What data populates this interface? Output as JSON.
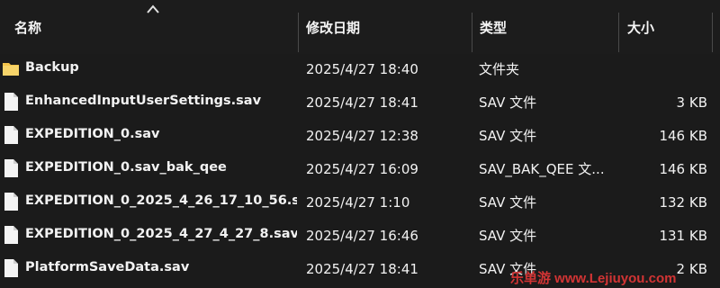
{
  "header": {
    "name_label": "名称",
    "modified_label": "修改日期",
    "type_label": "类型",
    "size_label": "大小"
  },
  "files": [
    {
      "name": "Backup",
      "modified": "2025/4/27 18:40",
      "type": "文件夹",
      "size": "",
      "icon": "folder-icon"
    },
    {
      "name": "EnhancedInputUserSettings.sav",
      "modified": "2025/4/27 18:41",
      "type": "SAV 文件",
      "size": "3 KB",
      "icon": "file-icon"
    },
    {
      "name": "EXPEDITION_0.sav",
      "modified": "2025/4/27 12:38",
      "type": "SAV 文件",
      "size": "146 KB",
      "icon": "file-icon"
    },
    {
      "name": "EXPEDITION_0.sav_bak_qee",
      "modified": "2025/4/27 16:09",
      "type": "SAV_BAK_QEE 文...",
      "size": "146 KB",
      "icon": "file-icon"
    },
    {
      "name": "EXPEDITION_0_2025_4_26_17_10_56.s...",
      "modified": "2025/4/27 1:10",
      "type": "SAV 文件",
      "size": "132 KB",
      "icon": "file-icon"
    },
    {
      "name": "EXPEDITION_0_2025_4_27_4_27_8.sav",
      "modified": "2025/4/27 16:46",
      "type": "SAV 文件",
      "size": "131 KB",
      "icon": "file-icon"
    },
    {
      "name": "PlatformSaveData.sav",
      "modified": "2025/4/27 18:41",
      "type": "SAV 文件",
      "size": "2 KB",
      "icon": "file-icon"
    }
  ],
  "watermark": "乐单游 www.Lejiuyou.com",
  "colors": {
    "background": "#1b1b1b",
    "text": "#f2f2f2",
    "folder": "#f4c44b",
    "watermark": "#d23434"
  }
}
